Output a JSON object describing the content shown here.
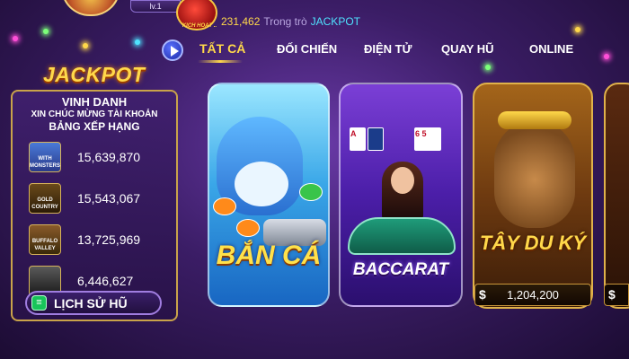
{
  "topbar": {
    "level": "lv.1",
    "jackpot_badge_text": "KICH HOẠT ..",
    "ticker_amount": "231,462",
    "ticker_mid": "Trong trò",
    "ticker_label": "JACKPOT"
  },
  "tabs": [
    {
      "label": "TẤT CẢ",
      "active": true
    },
    {
      "label": "ĐỐI CHIẾN",
      "active": false
    },
    {
      "label": "ĐIỆN TỬ",
      "active": false
    },
    {
      "label": "QUAY HŨ",
      "active": false
    },
    {
      "label": "ONLINE",
      "active": false
    }
  ],
  "leaderboard": {
    "jackpot_title": "JACKPOT",
    "heading": "VINH DANH",
    "subheading": "XIN CHÚC MỪNG TÀI KHOẢN",
    "ranking_label": "BẢNG XẾP HẠNG",
    "rows": [
      {
        "thumb": "WITH MONSTERS",
        "value": "15,639,870"
      },
      {
        "thumb": "GOLD COUNTRY",
        "value": "15,543,067"
      },
      {
        "thumb": "BUFFALO VALLEY",
        "value": "13,725,969"
      },
      {
        "thumb": "",
        "value": "6,446,627"
      }
    ],
    "history_label": "LỊCH SỬ HŨ"
  },
  "games": {
    "banca": {
      "title": "BẮN CÁ"
    },
    "baccarat": {
      "title": "BACCARAT",
      "cards_left": "A",
      "cards_right": "6 5"
    },
    "tayduky": {
      "title": "TÂY DU KÝ",
      "currency": "$",
      "jackpot": "1,204,200"
    },
    "partial": {
      "currency": "$"
    }
  },
  "colors": {
    "gold": "#ffd84a",
    "cyan": "#4fe3ff",
    "panel_border": "#c9a34a",
    "history_icon": "#18c45a"
  }
}
